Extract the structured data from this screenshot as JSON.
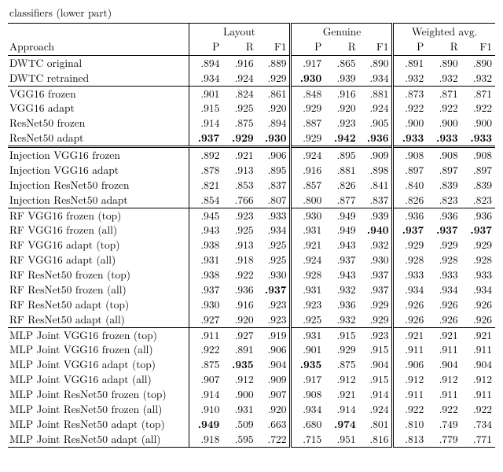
{
  "caption_fragment": "classifiers (lower part)",
  "columns": {
    "approach": "Approach",
    "group1": "Layout",
    "group2": "Genuine",
    "group3": "Weighted avg.",
    "P": "P",
    "R": "R",
    "F1": "F1"
  },
  "bold_cells": [
    [
      1,
      3
    ],
    [
      5,
      0
    ],
    [
      5,
      1
    ],
    [
      5,
      2
    ],
    [
      5,
      4
    ],
    [
      5,
      5
    ],
    [
      5,
      6
    ],
    [
      5,
      7
    ],
    [
      5,
      8
    ],
    [
      11,
      5
    ],
    [
      11,
      6
    ],
    [
      11,
      7
    ],
    [
      11,
      8
    ],
    [
      15,
      2
    ],
    [
      20,
      1
    ],
    [
      20,
      3
    ],
    [
      24,
      0
    ],
    [
      24,
      4
    ]
  ],
  "groups": [
    [
      {
        "name": "DWTC original",
        "v": [
          ".894",
          ".916",
          ".889",
          ".917",
          ".865",
          ".890",
          ".891",
          ".890",
          ".890"
        ]
      },
      {
        "name": "DWTC retrained",
        "v": [
          ".934",
          ".924",
          ".929",
          ".930",
          ".939",
          ".934",
          ".932",
          ".932",
          ".932"
        ]
      }
    ],
    [
      {
        "name": "VGG16 frozen",
        "v": [
          ".901",
          ".824",
          ".861",
          ".848",
          ".916",
          ".881",
          ".873",
          ".871",
          ".871"
        ]
      },
      {
        "name": "VGG16 adapt",
        "v": [
          ".915",
          ".925",
          ".920",
          ".929",
          ".920",
          ".924",
          ".922",
          ".922",
          ".922"
        ]
      },
      {
        "name": "ResNet50 frozen",
        "v": [
          ".914",
          ".875",
          ".894",
          ".887",
          ".923",
          ".905",
          ".900",
          ".900",
          ".900"
        ]
      },
      {
        "name": "ResNet50 adapt",
        "v": [
          ".937",
          ".929",
          ".930",
          ".929",
          ".942",
          ".936",
          ".933",
          ".933",
          ".933"
        ]
      }
    ],
    [
      {
        "name": "Injection VGG16 frozen",
        "v": [
          ".892",
          ".921",
          ".906",
          ".924",
          ".895",
          ".909",
          ".908",
          ".908",
          ".908"
        ]
      },
      {
        "name": "Injection VGG16 adapt",
        "v": [
          ".878",
          ".913",
          ".895",
          ".916",
          ".881",
          ".898",
          ".897",
          ".897",
          ".897"
        ]
      },
      {
        "name": "Injection ResNet50 frozen",
        "v": [
          ".821",
          ".853",
          ".837",
          ".857",
          ".826",
          ".841",
          ".840",
          ".839",
          ".839"
        ]
      },
      {
        "name": "Injection ResNet50 adapt",
        "v": [
          ".854",
          ".766",
          ".807",
          ".800",
          ".877",
          ".837",
          ".826",
          ".823",
          ".823"
        ]
      }
    ],
    [
      {
        "name": "RF VGG16 frozen (top)",
        "v": [
          ".945",
          ".923",
          ".933",
          ".930",
          ".949",
          ".939",
          ".936",
          ".936",
          ".936"
        ]
      },
      {
        "name": "RF VGG16 frozen (all)",
        "v": [
          ".943",
          ".925",
          ".934",
          ".931",
          ".949",
          ".940",
          ".937",
          ".937",
          ".937"
        ]
      },
      {
        "name": "RF VGG16 adapt (top)",
        "v": [
          ".938",
          ".913",
          ".925",
          ".921",
          ".943",
          ".932",
          ".929",
          ".929",
          ".929"
        ]
      },
      {
        "name": "RF VGG16 adapt (all)",
        "v": [
          ".931",
          ".918",
          ".925",
          ".924",
          ".937",
          ".930",
          ".928",
          ".928",
          ".928"
        ]
      },
      {
        "name": "RF ResNet50 frozen (top)",
        "v": [
          ".938",
          ".922",
          ".930",
          ".928",
          ".943",
          ".937",
          ".933",
          ".933",
          ".933"
        ]
      },
      {
        "name": "RF ResNet50 frozen (all)",
        "v": [
          ".937",
          ".936",
          ".937",
          ".931",
          ".932",
          ".937",
          ".934",
          ".934",
          ".934"
        ]
      },
      {
        "name": "RF ResNet50 adapt (top)",
        "v": [
          ".930",
          ".916",
          ".923",
          ".923",
          ".936",
          ".929",
          ".926",
          ".926",
          ".926"
        ]
      },
      {
        "name": "RF ResNet50 adapt (all)",
        "v": [
          ".927",
          ".920",
          ".923",
          ".925",
          ".932",
          ".929",
          ".926",
          ".926",
          ".926"
        ]
      }
    ],
    [
      {
        "name": "MLP Joint VGG16 frozen (top)",
        "v": [
          ".911",
          ".927",
          ".919",
          ".931",
          ".915",
          ".923",
          ".921",
          ".921",
          ".921"
        ]
      },
      {
        "name": "MLP Joint VGG16 frozen (all)",
        "v": [
          ".922",
          ".891",
          ".906",
          ".901",
          ".929",
          ".915",
          ".911",
          ".911",
          ".911"
        ]
      },
      {
        "name": "MLP Joint VGG16 adapt (top)",
        "v": [
          ".875",
          ".935",
          ".904",
          ".935",
          ".875",
          ".904",
          ".906",
          ".904",
          ".904"
        ]
      },
      {
        "name": "MLP Joint VGG16 adapt (all)",
        "v": [
          ".907",
          ".912",
          ".909",
          ".917",
          ".912",
          ".915",
          ".912",
          ".912",
          ".912"
        ]
      },
      {
        "name": "MLP Joint ResNet50 frozen (top)",
        "v": [
          ".914",
          ".900",
          ".907",
          ".908",
          ".921",
          ".914",
          ".911",
          ".911",
          ".911"
        ]
      },
      {
        "name": "MLP Joint ResNet50 frozen (all)",
        "v": [
          ".910",
          ".931",
          ".920",
          ".934",
          ".914",
          ".924",
          ".922",
          ".922",
          ".922"
        ]
      },
      {
        "name": "MLP Joint ResNet50 adapt (top)",
        "v": [
          ".949",
          ".509",
          ".663",
          ".680",
          ".974",
          ".801",
          ".810",
          ".749",
          ".734"
        ]
      },
      {
        "name": "MLP Joint ResNet50 adapt (all)",
        "v": [
          ".918",
          ".595",
          ".722",
          ".715",
          ".951",
          ".816",
          ".813",
          ".779",
          ".771"
        ]
      }
    ]
  ],
  "chart_data": {
    "type": "table",
    "title": "classifiers (lower part)",
    "columns": [
      "Approach",
      "Layout P",
      "Layout R",
      "Layout F1",
      "Genuine P",
      "Genuine R",
      "Genuine F1",
      "Weighted avg. P",
      "Weighted avg. R",
      "Weighted avg. F1"
    ],
    "rows": [
      [
        "DWTC original",
        0.894,
        0.916,
        0.889,
        0.917,
        0.865,
        0.89,
        0.891,
        0.89,
        0.89
      ],
      [
        "DWTC retrained",
        0.934,
        0.924,
        0.929,
        0.93,
        0.939,
        0.934,
        0.932,
        0.932,
        0.932
      ],
      [
        "VGG16 frozen",
        0.901,
        0.824,
        0.861,
        0.848,
        0.916,
        0.881,
        0.873,
        0.871,
        0.871
      ],
      [
        "VGG16 adapt",
        0.915,
        0.925,
        0.92,
        0.929,
        0.92,
        0.924,
        0.922,
        0.922,
        0.922
      ],
      [
        "ResNet50 frozen",
        0.914,
        0.875,
        0.894,
        0.887,
        0.923,
        0.905,
        0.9,
        0.9,
        0.9
      ],
      [
        "ResNet50 adapt",
        0.937,
        0.929,
        0.93,
        0.929,
        0.942,
        0.936,
        0.933,
        0.933,
        0.933
      ],
      [
        "Injection VGG16 frozen",
        0.892,
        0.921,
        0.906,
        0.924,
        0.895,
        0.909,
        0.908,
        0.908,
        0.908
      ],
      [
        "Injection VGG16 adapt",
        0.878,
        0.913,
        0.895,
        0.916,
        0.881,
        0.898,
        0.897,
        0.897,
        0.897
      ],
      [
        "Injection ResNet50 frozen",
        0.821,
        0.853,
        0.837,
        0.857,
        0.826,
        0.841,
        0.84,
        0.839,
        0.839
      ],
      [
        "Injection ResNet50 adapt",
        0.854,
        0.766,
        0.807,
        0.8,
        0.877,
        0.837,
        0.826,
        0.823,
        0.823
      ],
      [
        "RF VGG16 frozen (top)",
        0.945,
        0.923,
        0.933,
        0.93,
        0.949,
        0.939,
        0.936,
        0.936,
        0.936
      ],
      [
        "RF VGG16 frozen (all)",
        0.943,
        0.925,
        0.934,
        0.931,
        0.949,
        0.94,
        0.937,
        0.937,
        0.937
      ],
      [
        "RF VGG16 adapt (top)",
        0.938,
        0.913,
        0.925,
        0.921,
        0.943,
        0.932,
        0.929,
        0.929,
        0.929
      ],
      [
        "RF VGG16 adapt (all)",
        0.931,
        0.918,
        0.925,
        0.924,
        0.937,
        0.93,
        0.928,
        0.928,
        0.928
      ],
      [
        "RF ResNet50 frozen (top)",
        0.938,
        0.922,
        0.93,
        0.928,
        0.943,
        0.937,
        0.933,
        0.933,
        0.933
      ],
      [
        "RF ResNet50 frozen (all)",
        0.937,
        0.936,
        0.937,
        0.931,
        0.932,
        0.937,
        0.934,
        0.934,
        0.934
      ],
      [
        "RF ResNet50 adapt (top)",
        0.93,
        0.916,
        0.923,
        0.923,
        0.936,
        0.929,
        0.926,
        0.926,
        0.926
      ],
      [
        "RF ResNet50 adapt (all)",
        0.927,
        0.92,
        0.923,
        0.925,
        0.932,
        0.929,
        0.926,
        0.926,
        0.926
      ],
      [
        "MLP Joint VGG16 frozen (top)",
        0.911,
        0.927,
        0.919,
        0.931,
        0.915,
        0.923,
        0.921,
        0.921,
        0.921
      ],
      [
        "MLP Joint VGG16 frozen (all)",
        0.922,
        0.891,
        0.906,
        0.901,
        0.929,
        0.915,
        0.911,
        0.911,
        0.911
      ],
      [
        "MLP Joint VGG16 adapt (top)",
        0.875,
        0.935,
        0.904,
        0.935,
        0.875,
        0.904,
        0.906,
        0.904,
        0.904
      ],
      [
        "MLP Joint VGG16 adapt (all)",
        0.907,
        0.912,
        0.909,
        0.917,
        0.912,
        0.915,
        0.912,
        0.912,
        0.912
      ],
      [
        "MLP Joint ResNet50 frozen (top)",
        0.914,
        0.9,
        0.907,
        0.908,
        0.921,
        0.914,
        0.911,
        0.911,
        0.911
      ],
      [
        "MLP Joint ResNet50 frozen (all)",
        0.91,
        0.931,
        0.92,
        0.934,
        0.914,
        0.924,
        0.922,
        0.922,
        0.922
      ],
      [
        "MLP Joint ResNet50 adapt (top)",
        0.949,
        0.509,
        0.663,
        0.68,
        0.974,
        0.801,
        0.81,
        0.749,
        0.734
      ],
      [
        "MLP Joint ResNet50 adapt (all)",
        0.918,
        0.595,
        0.722,
        0.715,
        0.951,
        0.816,
        0.813,
        0.779,
        0.771
      ]
    ]
  }
}
